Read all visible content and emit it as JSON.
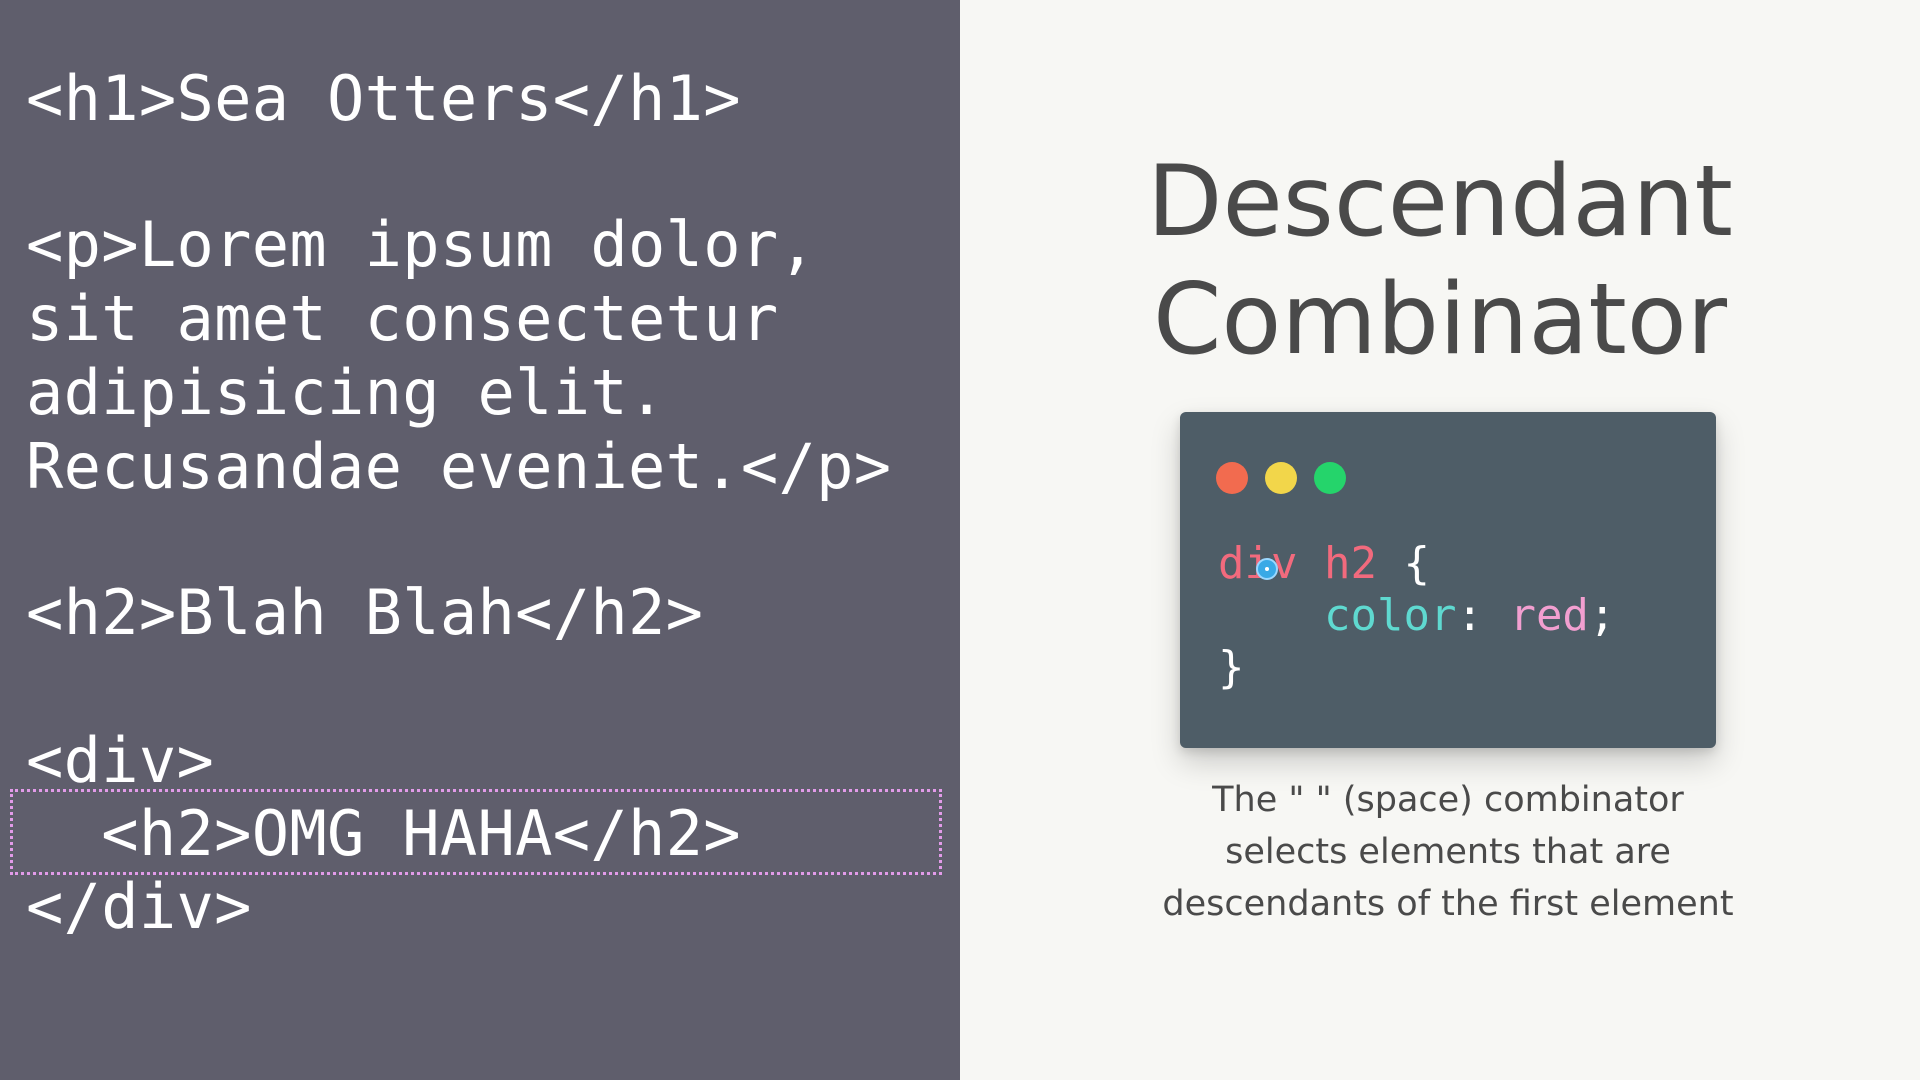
{
  "html_code": {
    "lines": [
      "<h1>Sea Otters</h1>",
      "<p>Lorem ipsum dolor,",
      "sit amet consectetur",
      "adipisicing elit.",
      "Recusandae eveniet.</p>",
      "<h2>Blah Blah</h2>",
      "<div>",
      "  <h2>OMG HAHA</h2>",
      "</div>"
    ]
  },
  "title": {
    "line1": "Descendant",
    "line2": "Combinator"
  },
  "css_snippet": {
    "selector_part1": "div",
    "selector_part2": "h2",
    "open_brace": "{",
    "property": "color",
    "colon": ":",
    "value": "red",
    "semicolon": ";",
    "close_brace": "}"
  },
  "caption": {
    "line1": "The \" \" (space) combinator",
    "line2": "selects elements that are",
    "line3": "descendants of the first element"
  },
  "colors": {
    "code_panel_bg": "#5f5e6c",
    "code_window_bg": "#4e5d67",
    "highlight_border": "#e29be9",
    "selector": "#f26a7d",
    "property": "#5fd9d0",
    "value": "#f29fd0",
    "punctuation": "#ffffff",
    "dot_red": "#f26b4f",
    "dot_yellow": "#f2d64a",
    "dot_green": "#25d46b"
  },
  "icons": {
    "window_dots": [
      "close-dot",
      "minimize-dot",
      "maximize-dot"
    ],
    "cursor": "cursor-indicator-icon"
  }
}
